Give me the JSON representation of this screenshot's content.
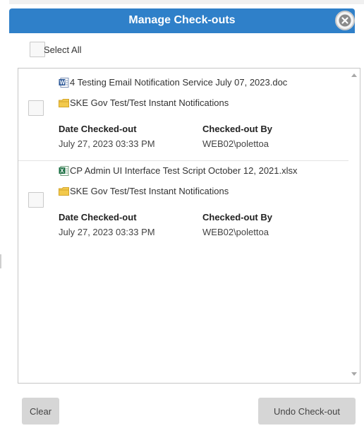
{
  "dialog": {
    "title": "Manage Check-outs",
    "close_icon": "close-circle-icon"
  },
  "select_all": {
    "label": "Select All",
    "checked": false
  },
  "items": [
    {
      "checked": false,
      "file_icon": "word-document-icon",
      "file_name": "4 Testing Email Notification Service July 07, 2023.doc",
      "folder_icon": "folder-icon",
      "folder_path": "SKE Gov Test/Test Instant Notifications",
      "date_label": "Date Checked-out",
      "date_value": "July 27, 2023 03:33 PM",
      "by_label": "Checked-out By",
      "by_value": "WEB02\\polettoa"
    },
    {
      "checked": false,
      "file_icon": "excel-spreadsheet-icon",
      "file_name": "CP Admin UI Interface Test Script October 12, 2021.xlsx",
      "folder_icon": "folder-icon",
      "folder_path": "SKE Gov Test/Test Instant Notifications",
      "date_label": "Date Checked-out",
      "date_value": "July 27, 2023 03:33 PM",
      "by_label": "Checked-out By",
      "by_value": "WEB02\\polettoa"
    }
  ],
  "buttons": {
    "clear": "Clear",
    "undo": "Undo Check-out"
  },
  "colors": {
    "titlebar": "#2f80c9",
    "button": "#d6d6d6",
    "folder": "#f2c94c"
  }
}
